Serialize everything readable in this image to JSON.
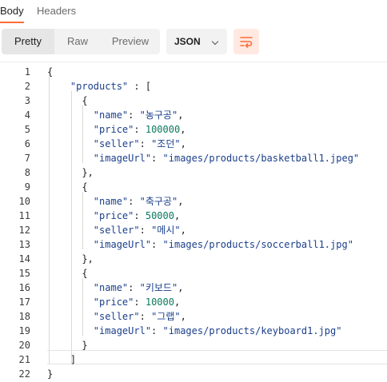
{
  "tabs": [
    {
      "label": "Body"
    },
    {
      "label": "Headers"
    }
  ],
  "view_modes": [
    {
      "label": "Pretty"
    },
    {
      "label": "Raw"
    },
    {
      "label": "Preview"
    }
  ],
  "format_select": {
    "value": "JSON"
  },
  "colors": {
    "accent": "#ff6c37",
    "string": "#1b3f8b",
    "number": "#0b7a5c"
  },
  "code": {
    "line_numbers": [
      "1",
      "2",
      "3",
      "4",
      "5",
      "6",
      "7",
      "8",
      "9",
      "10",
      "11",
      "12",
      "13",
      "14",
      "15",
      "16",
      "17",
      "18",
      "19",
      "20",
      "21",
      "22"
    ],
    "lines": [
      "{",
      "    \"products\" : [",
      "      {",
      "        \"name\": \"농구공\",",
      "        \"price\": 100000,",
      "        \"seller\": \"조던\",",
      "        \"imageUrl\": \"images/products/basketball1.jpeg\"",
      "      },",
      "      {",
      "        \"name\": \"축구공\",",
      "        \"price\": 50000,",
      "        \"seller\": \"메시\",",
      "        \"imageUrl\": \"images/products/soccerball1.jpg\"",
      "      },",
      "      {",
      "        \"name\": \"키보드\",",
      "        \"price\": 10000,",
      "        \"seller\": \"그랩\",",
      "        \"imageUrl\": \"images/products/keyboard1.jpg\"",
      "      }",
      "    ]",
      "}"
    ]
  }
}
